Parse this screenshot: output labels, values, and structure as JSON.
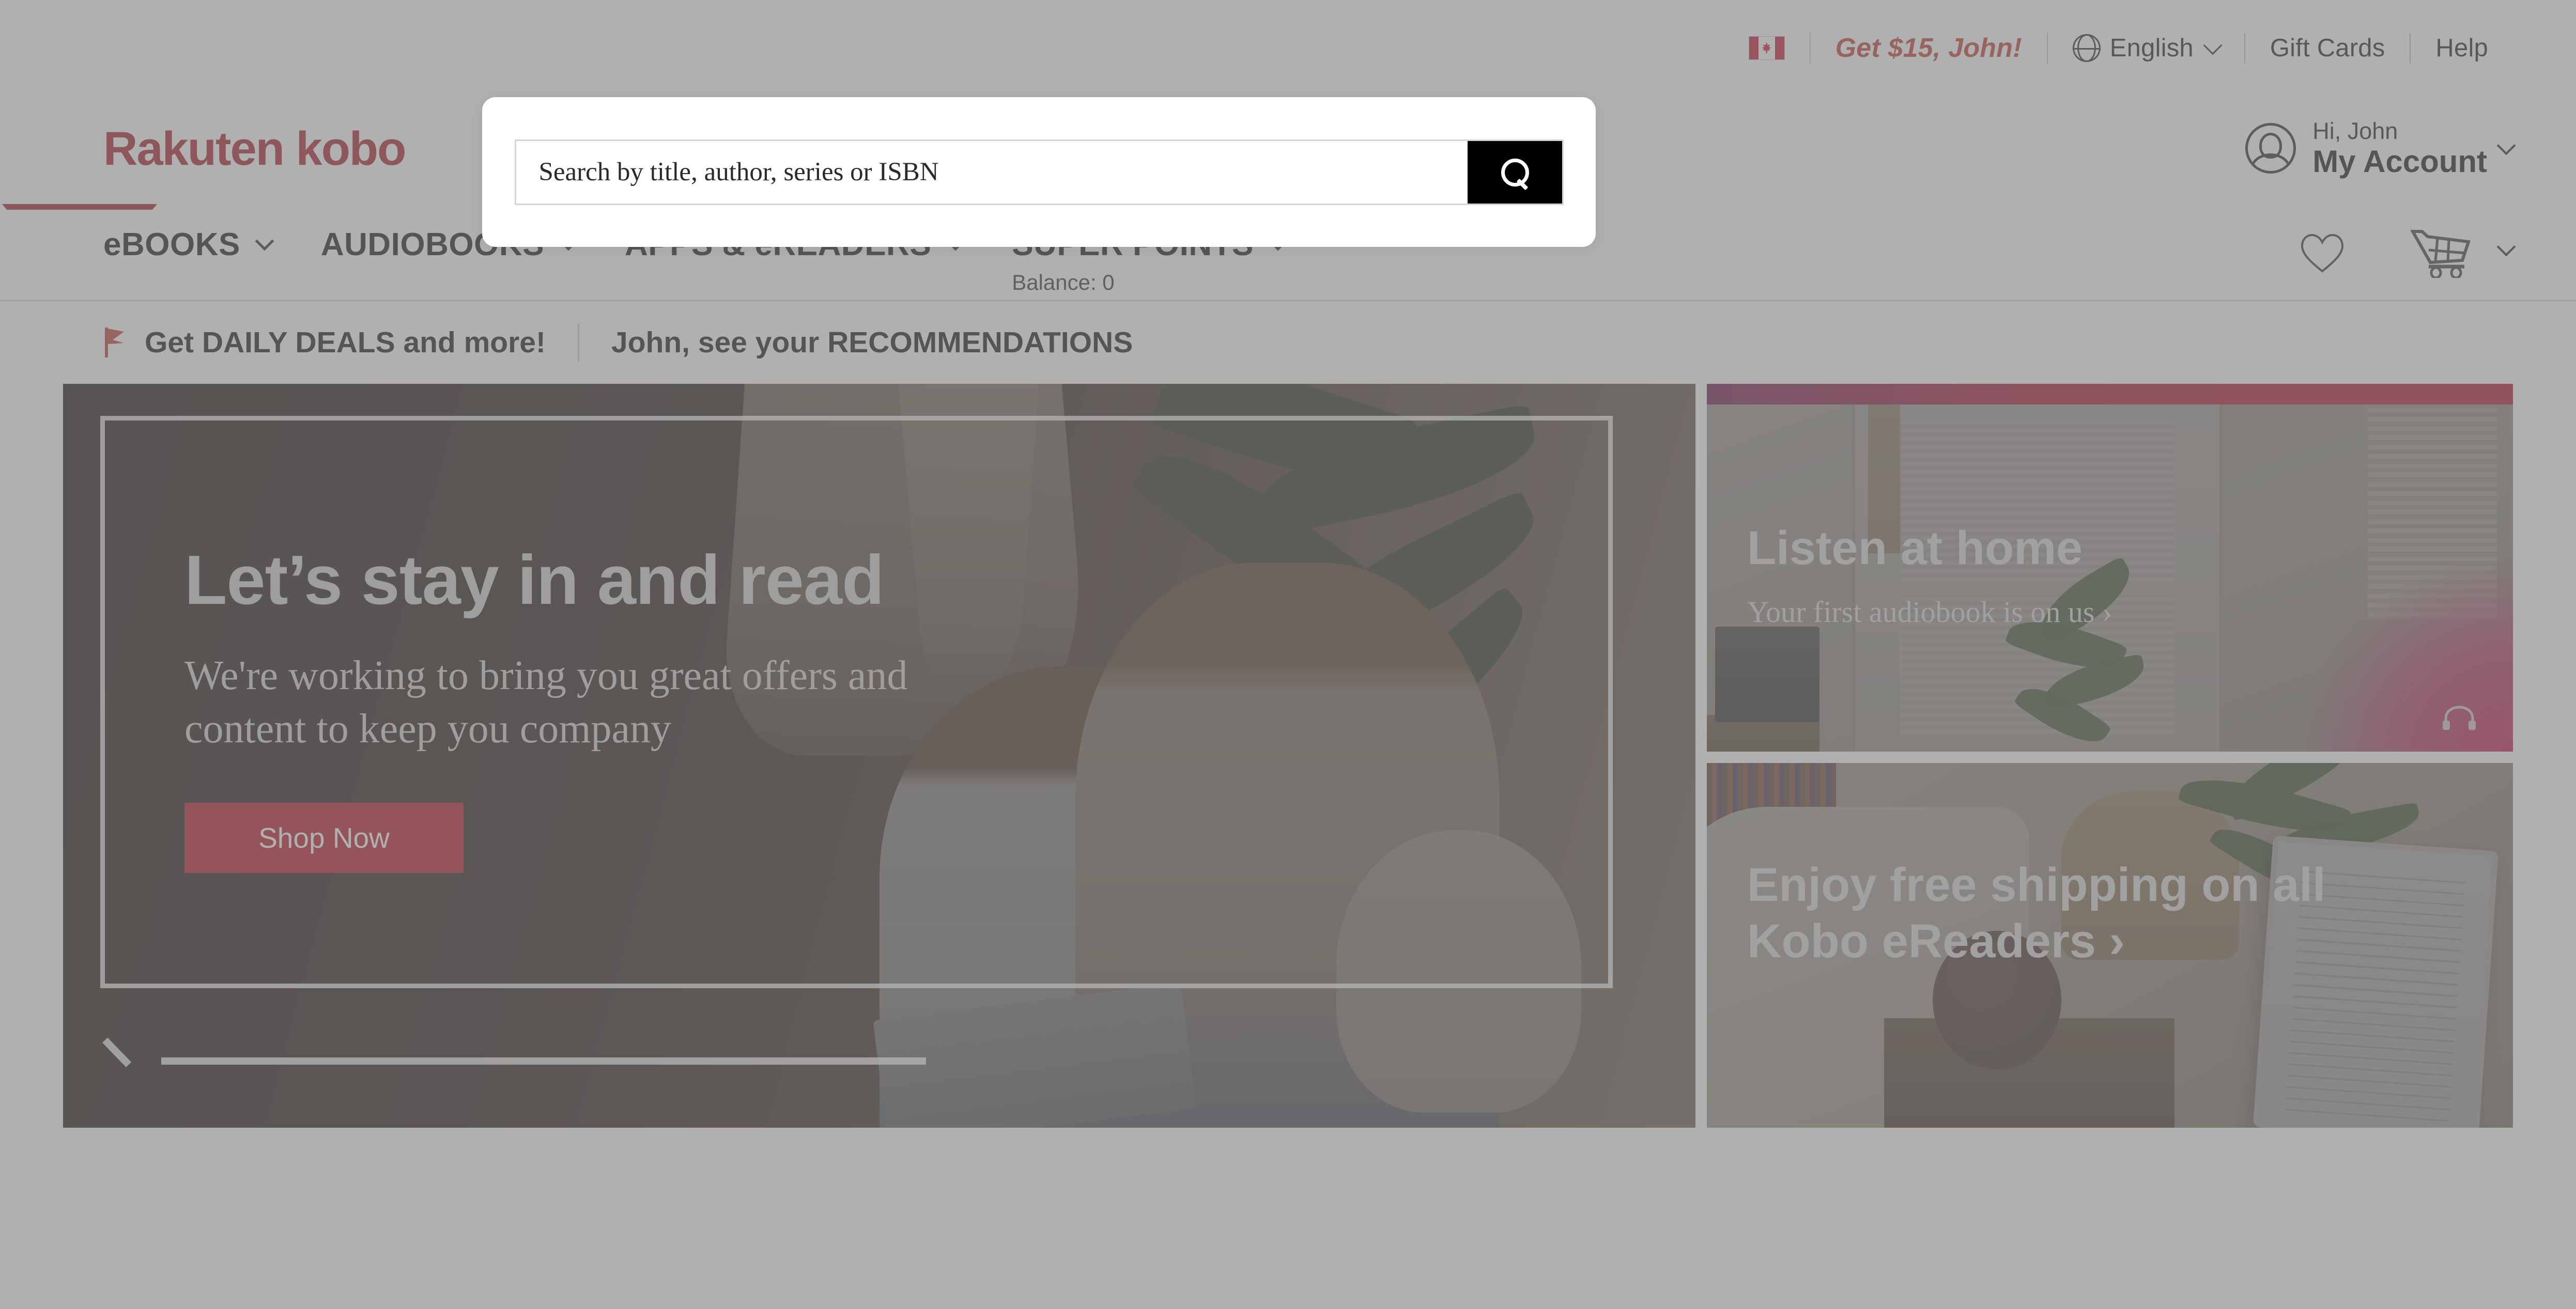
{
  "brand": {
    "logo_text": "Rakuten kobo",
    "accent_red": "#a31621",
    "promo_red": "#c0392b",
    "button_red": "#b80d1f"
  },
  "utility_bar": {
    "flag_icon": "canada-flag-icon",
    "promo_label": "Get $15, John!",
    "globe_icon": "globe-icon",
    "language": "English",
    "language_chevron": "chevron-down-icon",
    "gift_cards": "Gift Cards",
    "help": "Help"
  },
  "search": {
    "placeholder": "Search by title, author, series or ISBN",
    "value": "",
    "button_icon": "search-icon"
  },
  "account": {
    "avatar_icon": "avatar-icon",
    "greeting": "Hi, John",
    "label": "My Account",
    "chevron": "chevron-down-icon"
  },
  "nav": {
    "items": [
      {
        "label": "eBOOKS",
        "sub": ""
      },
      {
        "label": "AUDIOBOOKS",
        "sub": ""
      },
      {
        "label": "APPS & eREADERS",
        "sub": ""
      },
      {
        "label": "SUPER POINTS",
        "sub": "Balance: 0"
      }
    ],
    "wishlist_icon": "heart-icon",
    "cart_icon": "shopping-cart-icon",
    "cart_chevron": "chevron-down-icon"
  },
  "deals_strip": {
    "flag_icon": "red-flag-icon",
    "deals_label": "Get DAILY DEALS and more!",
    "recommendations_label": "John, see your RECOMMENDATIONS"
  },
  "hero": {
    "title": "Let’s stay in and read",
    "subtitle": "We're working to bring you great offers and content to keep you company",
    "cta_label": "Shop Now"
  },
  "cards": {
    "audiobook": {
      "title": "Listen at home",
      "subtitle": "Your first audiobook is on us ›",
      "icon": "headphones-icon",
      "band_color": "#a10f2e"
    },
    "ereader": {
      "title": "Enjoy free shipping on all Kobo eReaders ›"
    }
  }
}
